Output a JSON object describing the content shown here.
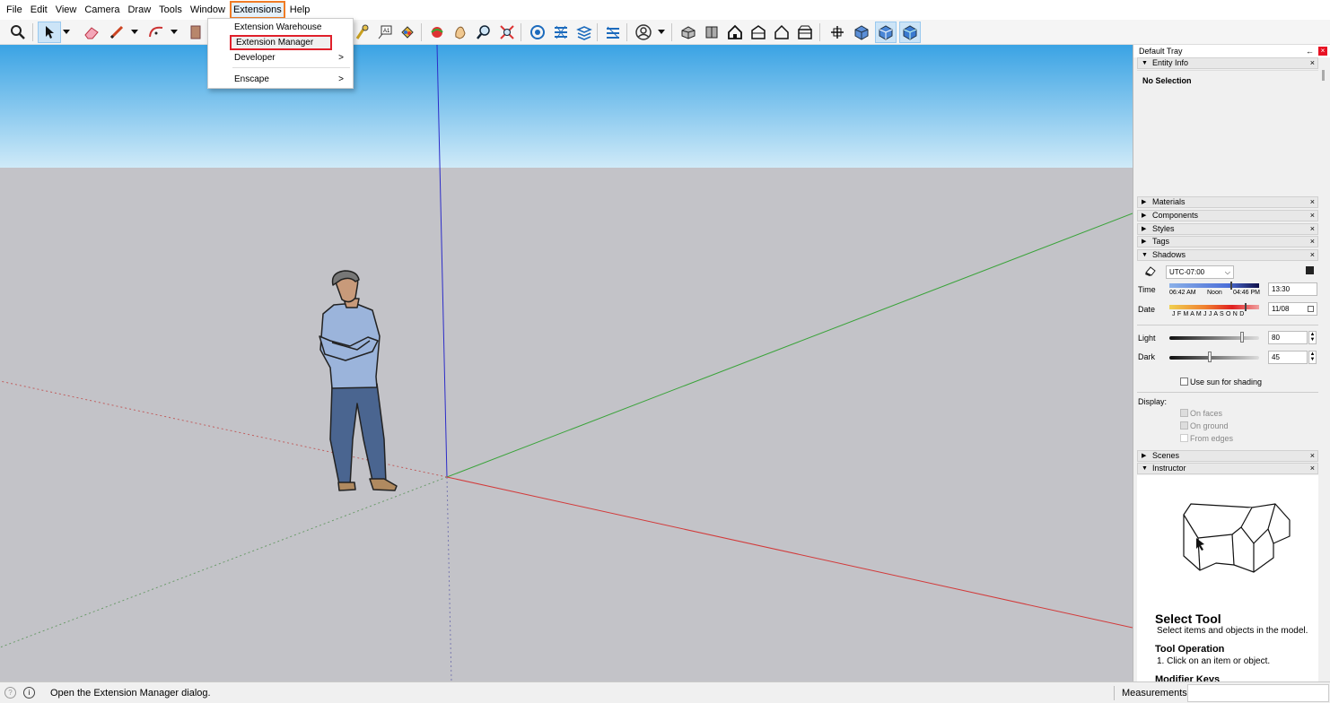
{
  "menubar": {
    "items": [
      "File",
      "Edit",
      "View",
      "Camera",
      "Draw",
      "Tools",
      "Window",
      "Extensions",
      "Help"
    ],
    "active_index": 7
  },
  "extensions_menu": {
    "items": [
      "Extension Warehouse",
      "Extension Manager",
      "Developer",
      "Enscape"
    ],
    "highlighted": "Extension Manager",
    "submenu_indicator": ">"
  },
  "tray": {
    "title": "Default Tray",
    "pin_glyph": "←",
    "close_glyph": "×",
    "entity_info": {
      "title": "Entity Info",
      "selection": "No Selection"
    },
    "collapsed_panels": [
      "Materials",
      "Components",
      "Styles",
      "Tags"
    ],
    "shadows": {
      "title": "Shadows",
      "timezone": "UTC-07:00",
      "time_label": "Time",
      "time_start": "06:42 AM",
      "time_mid": "Noon",
      "time_end": "04:46 PM",
      "time_value": "13:30",
      "date_label": "Date",
      "months": "J F M A M J J A S O N D",
      "date_value": "11/08",
      "light_label": "Light",
      "light_value": "80",
      "dark_label": "Dark",
      "dark_value": "45",
      "use_sun_label": "Use sun for shading",
      "display_label": "Display:",
      "on_faces": "On faces",
      "on_ground": "On ground",
      "from_edges": "From edges"
    },
    "scenes": {
      "title": "Scenes"
    },
    "instructor": {
      "title": "Instructor",
      "tool_name": "Select Tool",
      "tool_desc": "Select items and objects in the model.",
      "operation_heading": "Tool Operation",
      "operation_step": "1. Click on an item or object.",
      "modifier_heading": "Modifier Keys"
    }
  },
  "statusbar": {
    "message": "Open the Extension Manager dialog.",
    "measurements_label": "Measurements",
    "measurements_value": ""
  },
  "colors": {
    "sky_top": "#3aa3e4",
    "sky_bottom": "#cfeaf8",
    "ground": "#c3c3c8",
    "axis_red": "#d23a3a",
    "axis_green": "#3aa33a",
    "axis_blue": "#2c2cc8",
    "menu_active_outline": "#f07c26",
    "menu_item_highlight_outline": "#e0202b"
  }
}
